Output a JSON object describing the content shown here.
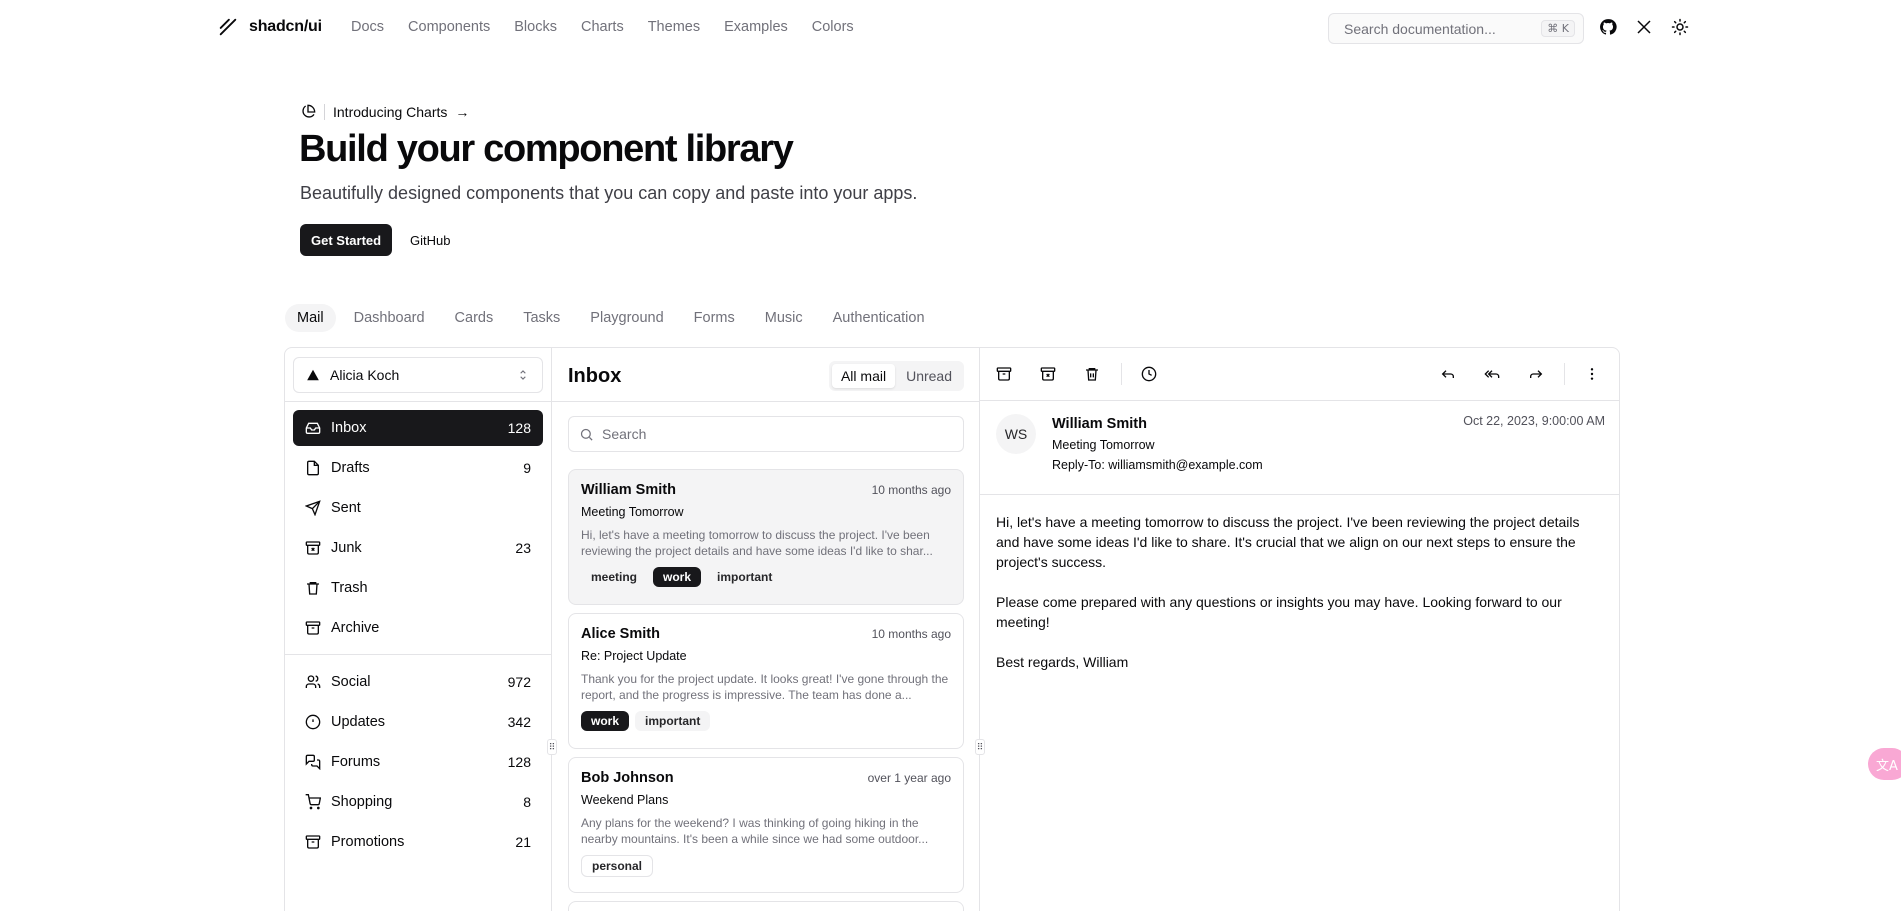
{
  "header": {
    "logo_text": "shadcn/ui",
    "nav": [
      "Docs",
      "Components",
      "Blocks",
      "Charts",
      "Themes",
      "Examples",
      "Colors"
    ],
    "search_placeholder": "Search documentation...",
    "search_shortcut": "⌘ K",
    "icons": [
      "github-icon",
      "x-icon",
      "sun-icon"
    ]
  },
  "hero": {
    "announcement": "Introducing Charts",
    "title": "Build your component library",
    "subtitle": "Beautifully designed components that you can copy and paste into your apps.",
    "primary_button": "Get Started",
    "secondary_button": "GitHub"
  },
  "example_tabs": [
    "Mail",
    "Dashboard",
    "Cards",
    "Tasks",
    "Playground",
    "Forms",
    "Music",
    "Authentication"
  ],
  "mail": {
    "account": "Alicia Koch",
    "folders": [
      {
        "label": "Inbox",
        "count": "128",
        "icon": "inbox-icon"
      },
      {
        "label": "Drafts",
        "count": "9",
        "icon": "file-icon"
      },
      {
        "label": "Sent",
        "count": "",
        "icon": "send-icon"
      },
      {
        "label": "Junk",
        "count": "23",
        "icon": "archive-x-icon"
      },
      {
        "label": "Trash",
        "count": "",
        "icon": "trash-icon"
      },
      {
        "label": "Archive",
        "count": "",
        "icon": "archive-icon"
      }
    ],
    "categories": [
      {
        "label": "Social",
        "count": "972",
        "icon": "users-icon"
      },
      {
        "label": "Updates",
        "count": "342",
        "icon": "alert-circle-icon"
      },
      {
        "label": "Forums",
        "count": "128",
        "icon": "messages-icon"
      },
      {
        "label": "Shopping",
        "count": "8",
        "icon": "cart-icon"
      },
      {
        "label": "Promotions",
        "count": "21",
        "icon": "archive-icon"
      }
    ],
    "list_title": "Inbox",
    "filter_all": "All mail",
    "filter_unread": "Unread",
    "search_placeholder": "Search",
    "messages": [
      {
        "from": "William Smith",
        "date": "10 months ago",
        "subject": "Meeting Tomorrow",
        "preview": "Hi, let's have a meeting tomorrow to discuss the project. I've been reviewing the project details and have some ideas I'd like to shar...",
        "tags": [
          "meeting",
          "work",
          "important"
        ]
      },
      {
        "from": "Alice Smith",
        "date": "10 months ago",
        "subject": "Re: Project Update",
        "preview": "Thank you for the project update. It looks great! I've gone through the report, and the progress is impressive. The team has done a...",
        "tags": [
          "work",
          "important"
        ]
      },
      {
        "from": "Bob Johnson",
        "date": "over 1 year ago",
        "subject": "Weekend Plans",
        "preview": "Any plans for the weekend? I was thinking of going hiking in the nearby mountains. It's been a while since we had some outdoor...",
        "tags": [
          "personal"
        ]
      }
    ],
    "detail": {
      "avatar": "WS",
      "from": "William Smith",
      "subject": "Meeting Tomorrow",
      "reply_to_label": "Reply-To:",
      "reply_to": "williamsmith@example.com",
      "date": "Oct 22, 2023, 9:00:00 AM",
      "body": [
        "Hi, let's have a meeting tomorrow to discuss the project. I've been reviewing the project details and have some ideas I'd like to share. It's crucial that we align on our next steps to ensure the project's success.",
        "Please come prepared with any questions or insights you may have. Looking forward to our meeting!",
        "Best regards, William"
      ]
    }
  },
  "translate_fab": "文A"
}
